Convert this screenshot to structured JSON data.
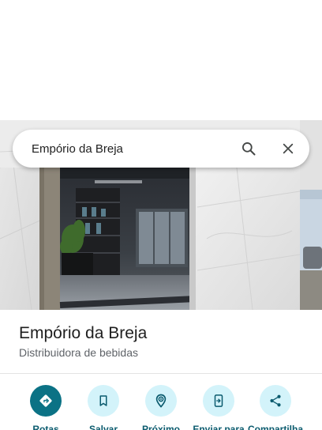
{
  "search": {
    "query": "Empório da Breja"
  },
  "place": {
    "name": "Empório da Breja",
    "category": "Distribuidora de bebidas"
  },
  "actions": [
    {
      "label": "Rotas",
      "icon": "directions-icon"
    },
    {
      "label": "Salvar",
      "icon": "bookmark-icon"
    },
    {
      "label": "Próximo",
      "icon": "nearby-icon"
    },
    {
      "label": "Enviar para",
      "icon": "send-to-phone-icon"
    },
    {
      "label": "Compartilha",
      "icon": "share-icon"
    }
  ],
  "colors": {
    "primary_action": "#0b7285",
    "secondary_action": "#d3f3fa",
    "action_label": "#0b5b6e"
  }
}
